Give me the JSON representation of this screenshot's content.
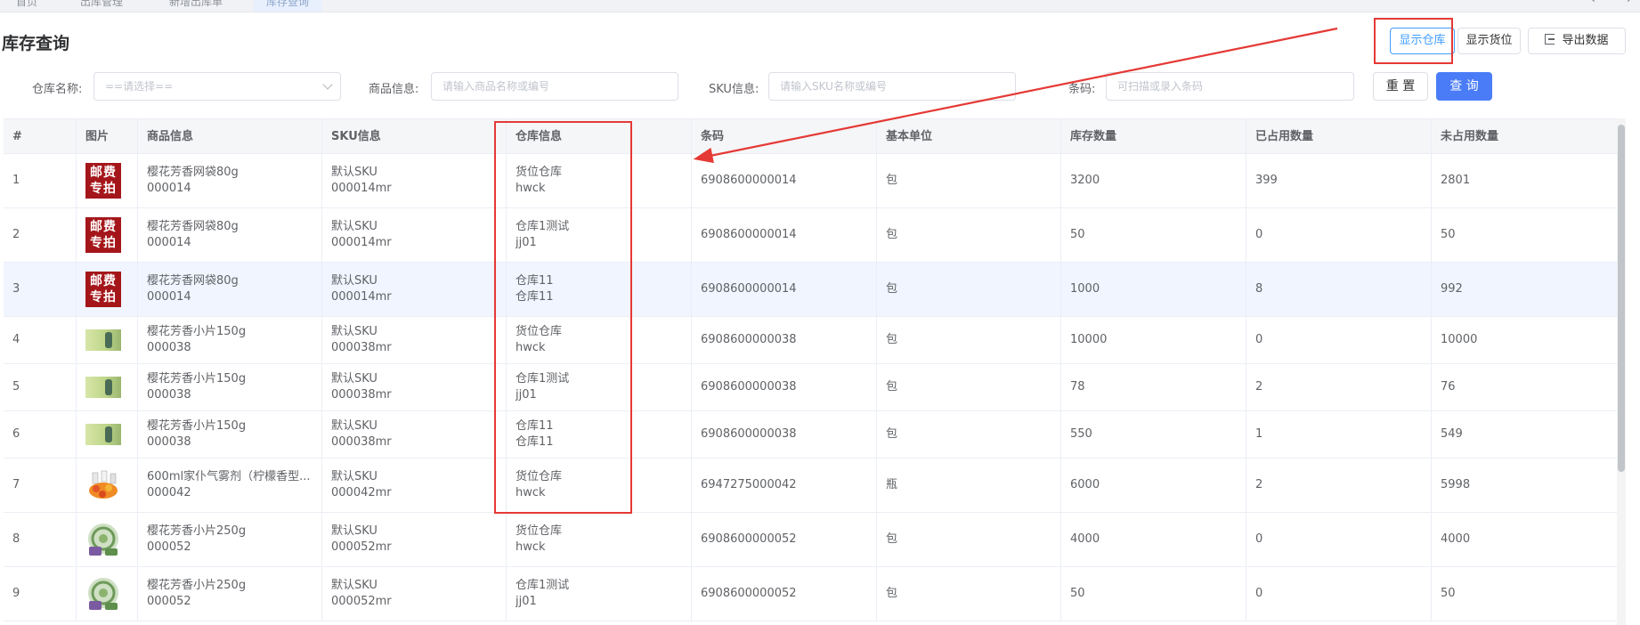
{
  "tabs": [
    "首页",
    "出库管理",
    "新增出库单",
    "库存查询"
  ],
  "header": {
    "title": "库存查询",
    "btn_show_warehouse": "显示仓库",
    "btn_show_location": "显示货位",
    "btn_export": "导出数据"
  },
  "filters": {
    "warehouse_label": "仓库名称:",
    "warehouse_placeholder": "==请选择==",
    "product_label": "商品信息:",
    "product_placeholder": "请输入商品名称或编号",
    "sku_label": "SKU信息:",
    "sku_placeholder": "请输入SKU名称或编号",
    "barcode_label": "条码:",
    "barcode_placeholder": "可扫描或录入条码",
    "reset": "重 置",
    "query": "查 询"
  },
  "table": {
    "columns": [
      "#",
      "图片",
      "商品信息",
      "SKU信息",
      "仓库信息",
      "条码",
      "基本单位",
      "库存数量",
      "已占用数量",
      "未占用数量"
    ],
    "rows": [
      {
        "idx": "1",
        "img": "red",
        "name": "樱花芳香网袋80g",
        "code": "000014",
        "sku": "默认SKU",
        "sku_code": "000014mr",
        "wh": "货位仓库",
        "wh_code": "hwck",
        "barcode": "6908600000014",
        "unit": "包",
        "stock": "3200",
        "used": "399",
        "free": "2801"
      },
      {
        "idx": "2",
        "img": "red",
        "name": "樱花芳香网袋80g",
        "code": "000014",
        "sku": "默认SKU",
        "sku_code": "000014mr",
        "wh": "仓库1测试",
        "wh_code": "jj01",
        "barcode": "6908600000014",
        "unit": "包",
        "stock": "50",
        "used": "0",
        "free": "50"
      },
      {
        "idx": "3",
        "img": "red",
        "name": "樱花芳香网袋80g",
        "code": "000014",
        "sku": "默认SKU",
        "sku_code": "000014mr",
        "wh": "仓库11",
        "wh_code": "仓库11",
        "barcode": "6908600000014",
        "unit": "包",
        "stock": "1000",
        "used": "8",
        "free": "992"
      },
      {
        "idx": "4",
        "img": "green",
        "name": "樱花芳香小片150g",
        "code": "000038",
        "sku": "默认SKU",
        "sku_code": "000038mr",
        "wh": "货位仓库",
        "wh_code": "hwck",
        "barcode": "6908600000038",
        "unit": "包",
        "stock": "10000",
        "used": "0",
        "free": "10000"
      },
      {
        "idx": "5",
        "img": "green",
        "name": "樱花芳香小片150g",
        "code": "000038",
        "sku": "默认SKU",
        "sku_code": "000038mr",
        "wh": "仓库1测试",
        "wh_code": "jj01",
        "barcode": "6908600000038",
        "unit": "包",
        "stock": "78",
        "used": "2",
        "free": "76"
      },
      {
        "idx": "6",
        "img": "green",
        "name": "樱花芳香小片150g",
        "code": "000038",
        "sku": "默认SKU",
        "sku_code": "000038mr",
        "wh": "仓库11",
        "wh_code": "仓库11",
        "barcode": "6908600000038",
        "unit": "包",
        "stock": "550",
        "used": "1",
        "free": "549"
      },
      {
        "idx": "7",
        "img": "spray",
        "name": "600ml家仆气雾剂（柠檬香型...",
        "code": "000042",
        "sku": "默认SKU",
        "sku_code": "000042mr",
        "wh": "货位仓库",
        "wh_code": "hwck",
        "barcode": "6947275000042",
        "unit": "瓶",
        "stock": "6000",
        "used": "2",
        "free": "5998"
      },
      {
        "idx": "8",
        "img": "round",
        "name": "樱花芳香小片250g",
        "code": "000052",
        "sku": "默认SKU",
        "sku_code": "000052mr",
        "wh": "货位仓库",
        "wh_code": "hwck",
        "barcode": "6908600000052",
        "unit": "包",
        "stock": "4000",
        "used": "0",
        "free": "4000"
      },
      {
        "idx": "9",
        "img": "round",
        "name": "樱花芳香小片250g",
        "code": "000052",
        "sku": "默认SKU",
        "sku_code": "000052mr",
        "wh": "仓库1测试",
        "wh_code": "jj01",
        "barcode": "6908600000052",
        "unit": "包",
        "stock": "50",
        "used": "0",
        "free": "50"
      }
    ]
  },
  "thumb_text": {
    "red": "邮费专拍"
  },
  "colors": {
    "primary": "#4a7cf7",
    "annotation": "#e53935",
    "highlight_row": "#f0f5ff"
  }
}
